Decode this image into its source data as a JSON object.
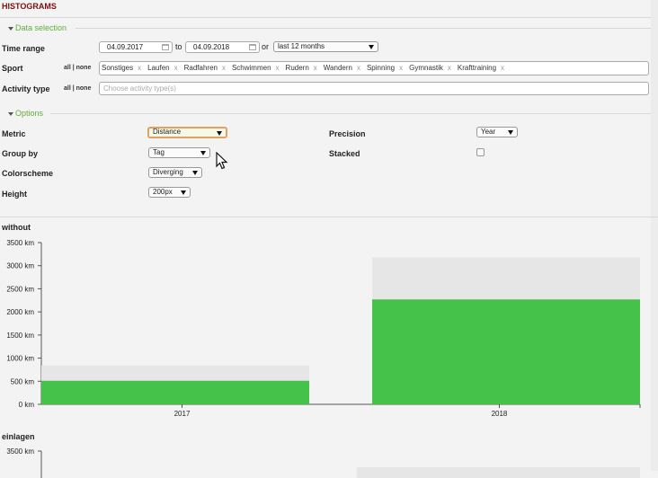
{
  "app": {
    "title": "HISTOGRAMS"
  },
  "data_selection": {
    "legend": "Data selection",
    "time_range": {
      "label": "Time range",
      "from": "04.09.2017",
      "to_label": "to",
      "to": "04.09.2018",
      "or_label": "or",
      "preset": "last 12 months"
    },
    "sport": {
      "label": "Sport",
      "all_none": "all | none",
      "tags": [
        "Sonstiges",
        "Laufen",
        "Radfahren",
        "Schwimmen",
        "Rudern",
        "Wandern",
        "Spinning",
        "Gymnastik",
        "Krafttraining"
      ],
      "remove_symbol": "x"
    },
    "activity_type": {
      "label": "Activity type",
      "all_none": "all | none",
      "placeholder": "Choose activity type(s)"
    }
  },
  "options": {
    "legend": "Options",
    "metric": {
      "label": "Metric",
      "value": "Distance"
    },
    "group_by": {
      "label": "Group by",
      "value": "Tag"
    },
    "colorscheme": {
      "label": "Colorscheme",
      "value": "Diverging"
    },
    "height": {
      "label": "Height",
      "value": "200px"
    },
    "precision": {
      "label": "Precision",
      "value": "Year"
    },
    "stacked": {
      "label": "Stacked",
      "checked": false
    }
  },
  "chart_data": [
    {
      "type": "bar",
      "title": "without",
      "categories": [
        "2017",
        "2018"
      ],
      "series": [
        {
          "values": [
            510,
            2270
          ]
        }
      ],
      "background_values": [
        840,
        3180
      ],
      "ylim": [
        0,
        3500
      ],
      "yticks": [
        "0 km",
        "500 km",
        "1000 km",
        "1500 km",
        "2000 km",
        "2500 km",
        "3000 km",
        "3500 km"
      ],
      "bar_color": "#44c24a",
      "background_color": "#e6e6e6"
    },
    {
      "type": "bar",
      "title": "einlagen",
      "yticks": [
        "3500 km"
      ]
    }
  ],
  "colors": {
    "title": "#7a1010",
    "legend": "#5fae3a",
    "bar": "#44c24a"
  }
}
